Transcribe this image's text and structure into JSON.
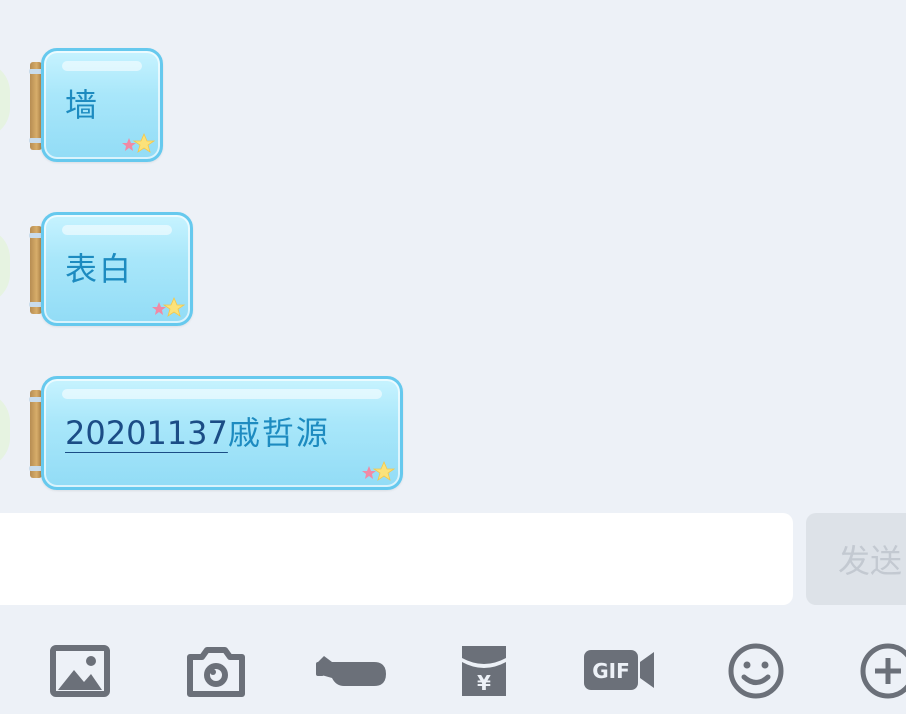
{
  "messages": [
    {
      "text": "墙"
    },
    {
      "text": "表白"
    },
    {
      "id_number": "20201137",
      "name": "戚哲源"
    }
  ],
  "input": {
    "value": "",
    "placeholder": ""
  },
  "send": {
    "label": "发送"
  },
  "toolbar": {
    "items": [
      "image-icon",
      "camera-icon",
      "poke-icon",
      "red-packet-icon",
      "gif-icon",
      "emoji-icon",
      "plus-icon"
    ]
  },
  "colors": {
    "background": "#edf1f7",
    "bubble_fill": "#a9e7fa",
    "bubble_border": "#66c9ee",
    "message_text": "#1d8bc0",
    "icon": "#6b7079"
  }
}
